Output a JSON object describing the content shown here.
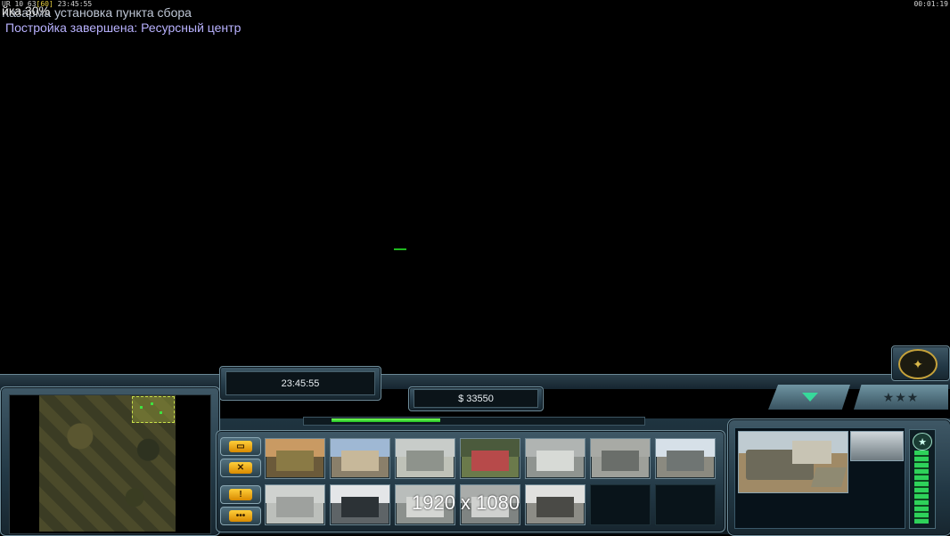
{
  "overlay": {
    "debug_prefix": "UR 10 63",
    "debug_fps": "[60]",
    "debug_time": "23:45:55",
    "overlay_fragment": "йка 30%",
    "elapsed_time": "00:01:19",
    "message_1": "Казарма установка пункта сбора",
    "message_2": "Постройка завершена: Ресурсный центр"
  },
  "hud": {
    "clock": "23:45:55",
    "money": "$ 33550",
    "power_level_fraction": 0.32,
    "side_buttons": [
      {
        "name": "build-tab-button",
        "icon": "window-icon",
        "glyph": "▭"
      },
      {
        "name": "upgrades-tab-button",
        "icon": "tools-icon",
        "glyph": "✕"
      },
      {
        "name": "alert-tab-button",
        "icon": "exclamation-icon",
        "glyph": "!"
      },
      {
        "name": "chat-tab-button",
        "icon": "speech-bubble-icon",
        "glyph": "•••"
      }
    ],
    "generals_tab": "★★★",
    "watermark": "1920 x 1080"
  },
  "build_options": [
    {
      "name": "command-center-cameo",
      "sky": "#c99a63",
      "ground": "#6b5a3a",
      "bld": "#8a7a45"
    },
    {
      "name": "barracks-cameo",
      "sky": "#9fb8d4",
      "ground": "#8a7f6a",
      "bld": "#c7b89a"
    },
    {
      "name": "supply-center-cameo",
      "sky": "#c8ccc9",
      "ground": "#bfc2b8",
      "bld": "#8e938c"
    },
    {
      "name": "patriot-battery-cameo",
      "sky": "#4b5a3c",
      "ground": "#6b7a4b",
      "bld": "#b74a4a"
    },
    {
      "name": "war-factory-cameo",
      "sky": "#b0b4b2",
      "ground": "#8f9490",
      "bld": "#d7dad6"
    },
    {
      "name": "airfield-cameo",
      "sky": "#a8aaa5",
      "ground": "#9ea09a",
      "bld": "#6a6e6a"
    },
    {
      "name": "strategy-center-cameo",
      "sky": "#d6e0e8",
      "ground": "#8b8a80",
      "bld": "#6f7573"
    },
    {
      "name": "detention-camp-cameo",
      "sky": "#cfd2cf",
      "ground": "#bcbfbb",
      "bld": "#9ea19e"
    },
    {
      "name": "fire-base-cameo",
      "sky": "#e4e6e8",
      "ground": "#5e6467",
      "bld": "#2c3236"
    },
    {
      "name": "cold-fusion-reactor-cameo",
      "sky": "#b9bdbb",
      "ground": "#8b908d",
      "bld": "#d4d6d3"
    },
    {
      "name": "particle-cannon-cameo",
      "sky": "#a9acaa",
      "ground": "#7f8482",
      "bld": "#cfd1cf"
    },
    {
      "name": "tunnel-cameo",
      "sky": "#e0e0de",
      "ground": "#8c8c86",
      "bld": "#4a4a46"
    }
  ]
}
